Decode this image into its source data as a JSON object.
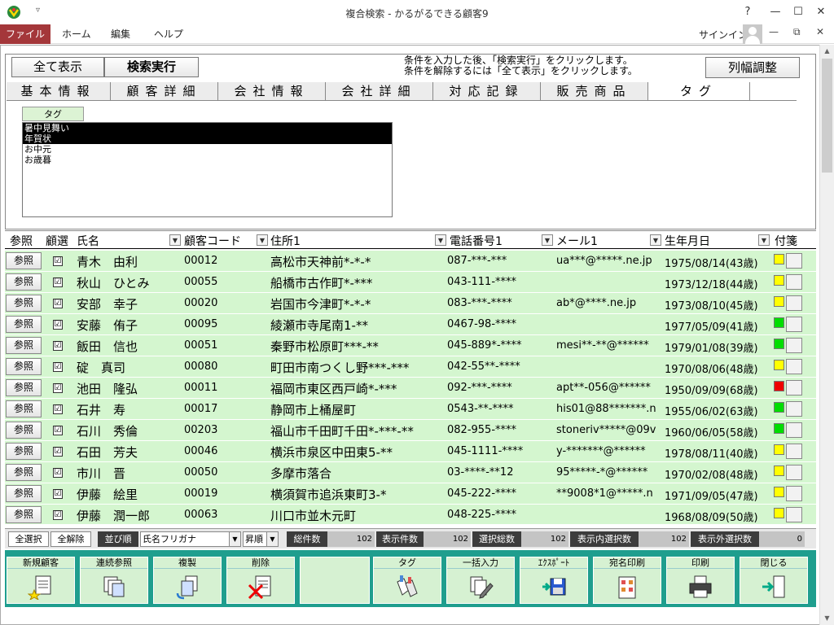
{
  "window": {
    "title": "複合検索 - かるがるできる顧客9",
    "qa_icon": "▿",
    "help_label": "?",
    "min_label": "—",
    "max_label": "☐",
    "close_label": "✕"
  },
  "ribbon": {
    "file": "ファイル",
    "home": "ホーム",
    "edit": "編集",
    "help": "ヘルプ",
    "signin": "サインイン",
    "minimize": "—",
    "restore": "⧉",
    "close": "✕"
  },
  "scrollbar": {
    "up": "▲",
    "down": "▼"
  },
  "search": {
    "show_all": "全て表示",
    "execute": "検索実行",
    "info_line1": "条件を入力した後、「検索実行」をクリックします。",
    "info_line2": "条件を解除するには「全て表示」をクリックします。",
    "col_width": "列幅調整"
  },
  "tabs": [
    "基本情報",
    "顧客詳細",
    "会社情報",
    "会社詳細",
    "対応記録",
    "販売商品",
    "タグ"
  ],
  "tag_panel": {
    "label": "タグ",
    "items": [
      {
        "text": "暑中見舞い",
        "selected": true
      },
      {
        "text": "年賀状",
        "selected": true
      },
      {
        "text": "お中元",
        "selected": false
      },
      {
        "text": "お歳暮",
        "selected": false
      }
    ]
  },
  "grid": {
    "headers": {
      "ref": "参照",
      "select": "顧選",
      "name": "氏名",
      "code": "顧客コード",
      "address": "住所1",
      "phone": "電話番号1",
      "mail": "メール1",
      "birth": "生年月日",
      "tag": "付箋",
      "dropdown": "▼"
    },
    "ref_label": "参照",
    "check": "☑",
    "rows": [
      {
        "name": "青木　由利",
        "code": "00012",
        "address": "高松市天神前*-*-*",
        "phone": "087-***-***",
        "mail": "ua***@*****.ne.jp",
        "birth": "1975/08/14(43歳)",
        "tag_color": "#ffff00"
      },
      {
        "name": "秋山　ひとみ",
        "code": "00055",
        "address": "船橋市古作町*-***",
        "phone": "043-111-****",
        "mail": "",
        "birth": "1973/12/18(44歳)",
        "tag_color": "#ffff00"
      },
      {
        "name": "安部　幸子",
        "code": "00020",
        "address": "岩国市今津町*-*-*",
        "phone": "083-***-****",
        "mail": "ab*@****.ne.jp",
        "birth": "1973/08/10(45歳)",
        "tag_color": "#ffff00"
      },
      {
        "name": "安藤　侑子",
        "code": "00095",
        "address": "綾瀬市寺尾南1-**",
        "phone": "0467-98-****",
        "mail": "",
        "birth": "1977/05/09(41歳)",
        "tag_color": "#00dd00"
      },
      {
        "name": "飯田　信也",
        "code": "00051",
        "address": "秦野市松原町***-**",
        "phone": "045-889*-****",
        "mail": "mesi**-**@******",
        "birth": "1979/01/08(39歳)",
        "tag_color": "#00dd00"
      },
      {
        "name": "碇　真司",
        "code": "00080",
        "address": "町田市南つくし野***-***",
        "phone": "042-55**-****",
        "mail": "",
        "birth": "1970/08/06(48歳)",
        "tag_color": "#ffff00"
      },
      {
        "name": "池田　隆弘",
        "code": "00011",
        "address": "福岡市東区西戸崎*-***",
        "phone": "092-***-****",
        "mail": "apt**-056@******",
        "birth": "1950/09/09(68歳)",
        "tag_color": "#ee0000"
      },
      {
        "name": "石井　寿",
        "code": "00017",
        "address": "静岡市上桶屋町",
        "phone": "0543-**-****",
        "mail": "his01@88*******.n",
        "birth": "1955/06/02(63歳)",
        "tag_color": "#00dd00"
      },
      {
        "name": "石川　秀倫",
        "code": "00203",
        "address": "福山市千田町千田*-***-**",
        "phone": "082-955-****",
        "mail": "stoneriv*****@09v",
        "birth": "1960/06/05(58歳)",
        "tag_color": "#00dd00"
      },
      {
        "name": "石田　芳夫",
        "code": "00046",
        "address": "横浜市泉区中田東5-**",
        "phone": "045-1111-****",
        "mail": "y-*******@******",
        "birth": "1978/08/11(40歳)",
        "tag_color": "#ffff00"
      },
      {
        "name": "市川　晋",
        "code": "00050",
        "address": "多摩市落合",
        "phone": "03-****-**12",
        "mail": "95*****-*@******",
        "birth": "1970/02/08(48歳)",
        "tag_color": "#ffff00"
      },
      {
        "name": "伊藤　絵里",
        "code": "00019",
        "address": "横須賀市追浜東町3-*",
        "phone": "045-222-****",
        "mail": "**9008*1@*****.n",
        "birth": "1971/09/05(47歳)",
        "tag_color": "#ffff00"
      },
      {
        "name": "伊藤　潤一郎",
        "code": "00063",
        "address": "川口市並木元町",
        "phone": "048-225-****",
        "mail": "",
        "birth": "1968/08/09(50歳)",
        "tag_color": "#ffff00"
      }
    ]
  },
  "statusbar": {
    "select_all": "全選択",
    "deselect_all": "全解除",
    "sort_label": "並び順",
    "sort_field": "氏名フリガナ",
    "sort_order": "昇順",
    "dd": "▼",
    "total_label": "総件数",
    "total": "102",
    "shown_label": "表示件数",
    "shown": "102",
    "selected_label": "選択総数",
    "selected": "102",
    "sel_in_label": "表示内選択数",
    "sel_in": "102",
    "sel_out_label": "表示外選択数",
    "sel_out": "0"
  },
  "toolbar": {
    "new": "新規顧客",
    "cont_ref": "連続参照",
    "copy": "複製",
    "delete": "削除",
    "tag": "タグ",
    "bulk": "一括入力",
    "export": "ｴｸｽﾎﾟｰﾄ",
    "print_addr": "宛名印刷",
    "print": "印刷",
    "close": "閉じる"
  }
}
